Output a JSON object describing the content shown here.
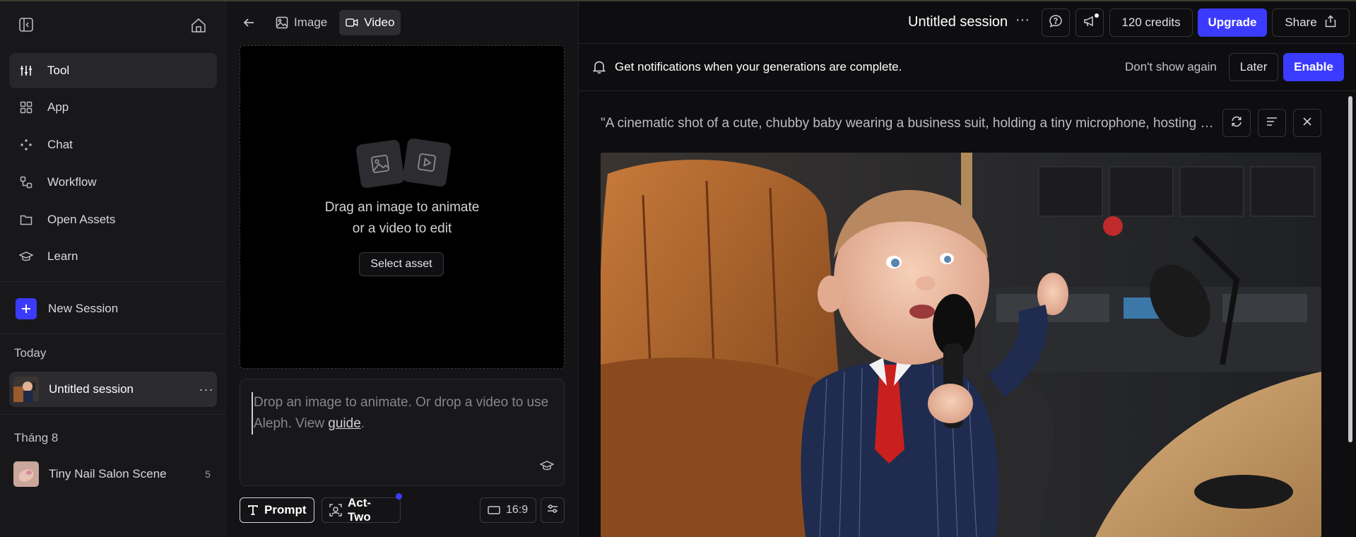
{
  "sidebar": {
    "nav": [
      {
        "label": "Tool",
        "icon": "sliders-icon"
      },
      {
        "label": "App",
        "icon": "grid-icon"
      },
      {
        "label": "Chat",
        "icon": "chat-dots-icon"
      },
      {
        "label": "Workflow",
        "icon": "workflow-icon"
      },
      {
        "label": "Open Assets",
        "icon": "folder-icon"
      },
      {
        "label": "Learn",
        "icon": "graduation-cap-icon"
      }
    ],
    "new_session": "New Session",
    "groups": {
      "today": "Today",
      "month": "Tháng 8"
    },
    "sessions": [
      {
        "title": "Untitled session",
        "more": "···"
      },
      {
        "title": "Tiny Nail Salon Scene",
        "count": "5"
      }
    ]
  },
  "middle": {
    "tabs": [
      {
        "label": "Image",
        "icon": "image-icon"
      },
      {
        "label": "Video",
        "icon": "video-icon"
      }
    ],
    "dropzone": {
      "line1": "Drag an image to animate",
      "line2": "or a video to edit",
      "select_asset": "Select asset"
    },
    "prompt": {
      "placeholder_before": "Drop an image to animate. Or drop a video to use Aleph. View ",
      "link": "guide",
      "placeholder_after": "."
    },
    "bottom": {
      "prompt_label": "Prompt",
      "act_two_label": "Act-Two",
      "ratio": "16:9"
    }
  },
  "header": {
    "session_title": "Untitled session",
    "more": "···",
    "credits": "120 credits",
    "upgrade": "Upgrade",
    "share": "Share"
  },
  "notification": {
    "message": "Get notifications when your generations are complete.",
    "dont_show": "Don't show again",
    "later": "Later",
    "enable": "Enable"
  },
  "generation": {
    "prompt": "\"A cinematic shot of a cute, chubby baby wearing a business suit, holding a tiny microphone, hosting a podcast\""
  },
  "colors": {
    "accent": "#3b3bff",
    "background": "#0e0e10",
    "sidebar": "#18181b"
  }
}
